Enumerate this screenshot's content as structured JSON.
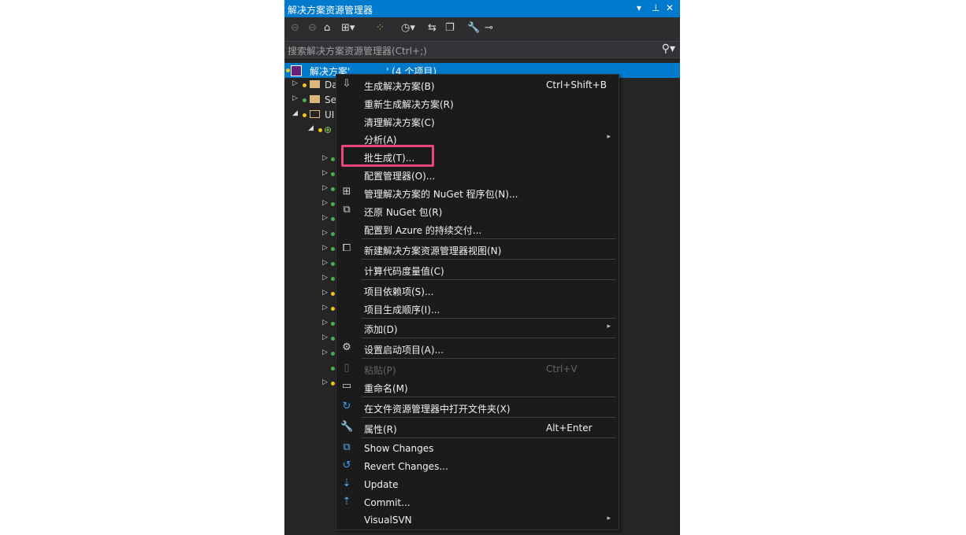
{
  "panel": {
    "title": "解决方案资源管理器",
    "title_buttons": [
      "▾",
      "⊥",
      "✕"
    ],
    "accent_color": "#007acc"
  },
  "toolbar": {
    "icons": [
      "back-icon",
      "forward-icon",
      "home-icon",
      "switch-views-icon",
      "pending-changes-filter-icon",
      "history-icon",
      "sync-icon",
      "collapse-all-icon",
      "properties-icon",
      "pin-icon"
    ]
  },
  "search": {
    "placeholder": "搜索解决方案资源管理器(Ctrl+;)",
    "icon": "search-icon"
  },
  "tree": {
    "solution_label": "解决方案'            ' (4 个项目)",
    "items": [
      {
        "label": "Da"
      },
      {
        "label": "Se"
      },
      {
        "label": "UI"
      }
    ]
  },
  "context_menu": {
    "items": [
      {
        "icon": "build-icon",
        "label": "生成解决方案(B)",
        "shortcut": "Ctrl+Shift+B"
      },
      {
        "icon": "",
        "label": "重新生成解决方案(R)",
        "shortcut": ""
      },
      {
        "icon": "",
        "label": "清理解决方案(C)",
        "shortcut": ""
      },
      {
        "icon": "",
        "label": "分析(A)",
        "shortcut": "",
        "submenu": "▸"
      },
      {
        "icon": "",
        "label": "批生成(T)...",
        "shortcut": ""
      },
      {
        "icon": "",
        "label": "配置管理器(O)...",
        "shortcut": ""
      },
      {
        "icon": "nuget-icon",
        "label": "管理解决方案的 NuGet 程序包(N)...",
        "shortcut": ""
      },
      {
        "icon": "restore-icon",
        "label": "还原 NuGet 包(R)",
        "shortcut": ""
      },
      {
        "icon": "",
        "label": "配置到 Azure 的持续交付...",
        "shortcut": ""
      },
      {
        "icon": "new-view-icon",
        "label": "新建解决方案资源管理器视图(N)",
        "shortcut": ""
      },
      {
        "icon": "",
        "label": "计算代码度量值(C)",
        "shortcut": ""
      },
      {
        "icon": "",
        "label": "项目依赖项(S)...",
        "shortcut": ""
      },
      {
        "icon": "",
        "label": "项目生成顺序(I)...",
        "shortcut": ""
      },
      {
        "icon": "",
        "label": "添加(D)",
        "shortcut": "",
        "submenu": "▸"
      },
      {
        "icon": "gear-icon",
        "label": "设置启动项目(A)...",
        "shortcut": ""
      },
      {
        "icon": "paste-icon",
        "label": "粘贴(P)",
        "shortcut": "Ctrl+V",
        "disabled": true
      },
      {
        "icon": "rename-icon",
        "label": "重命名(M)",
        "shortcut": ""
      },
      {
        "icon": "open-folder-icon",
        "label": "在文件资源管理器中打开文件夹(X)",
        "shortcut": ""
      },
      {
        "icon": "wrench-icon",
        "label": "属性(R)",
        "shortcut": "Alt+Enter"
      },
      {
        "icon": "show-changes-icon",
        "label": "Show Changes",
        "shortcut": ""
      },
      {
        "icon": "revert-icon",
        "label": "Revert Changes...",
        "shortcut": ""
      },
      {
        "icon": "update-icon",
        "label": "Update",
        "shortcut": ""
      },
      {
        "icon": "commit-icon",
        "label": "Commit...",
        "shortcut": ""
      },
      {
        "icon": "",
        "label": "VisualSVN",
        "shortcut": "",
        "submenu": "▸"
      }
    ],
    "highlighted_item": "批生成(T)...",
    "highlight_color": "#e8457c"
  }
}
